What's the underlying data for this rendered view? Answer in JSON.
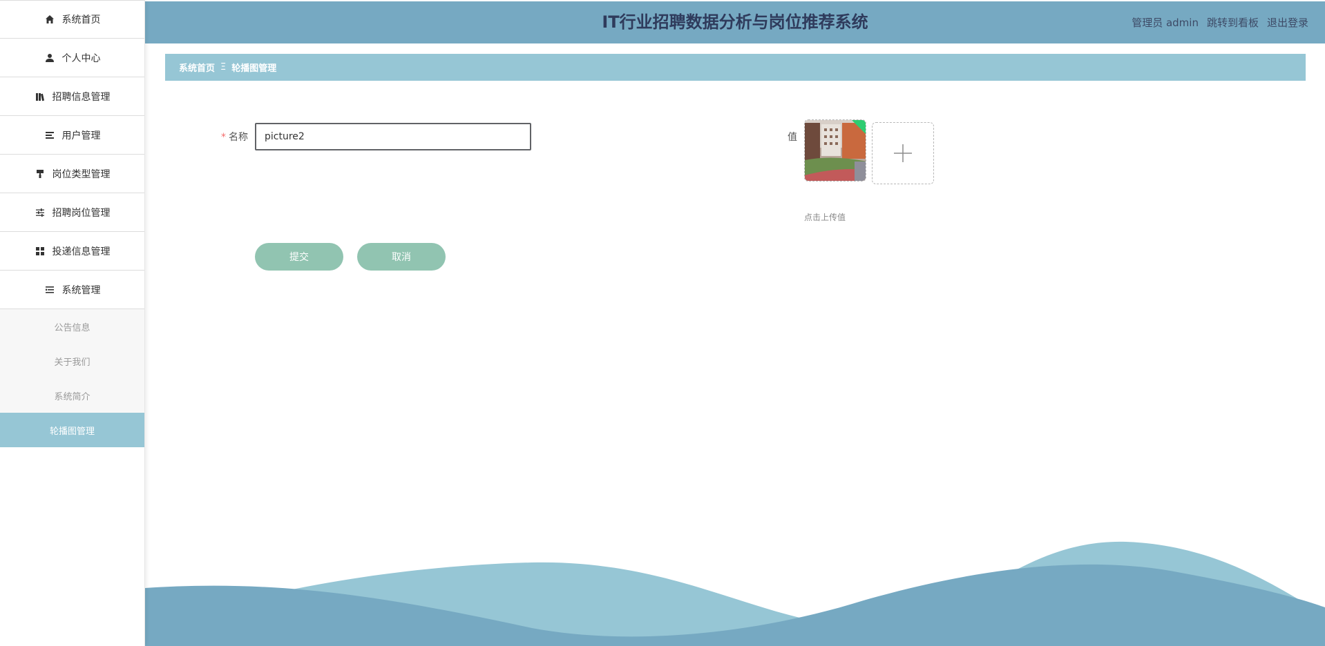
{
  "header": {
    "title": "IT行业招聘数据分析与岗位推荐系统",
    "user_label": "管理员 admin",
    "dashboard_link": "跳转到看板",
    "logout_link": "退出登录"
  },
  "sidebar": {
    "items": [
      {
        "label": "系统首页",
        "icon": "home-icon"
      },
      {
        "label": "个人中心",
        "icon": "user-icon"
      },
      {
        "label": "招聘信息管理",
        "icon": "library-icon"
      },
      {
        "label": "用户管理",
        "icon": "list-icon"
      },
      {
        "label": "岗位类型管理",
        "icon": "paint-roller-icon"
      },
      {
        "label": "招聘岗位管理",
        "icon": "sliders-icon"
      },
      {
        "label": "投递信息管理",
        "icon": "grid-icon"
      },
      {
        "label": "系统管理",
        "icon": "indent-list-icon"
      }
    ],
    "submenu": [
      {
        "label": "公告信息"
      },
      {
        "label": "关于我们"
      },
      {
        "label": "系统简介"
      },
      {
        "label": "轮播图管理",
        "active": true
      }
    ]
  },
  "breadcrumb": {
    "home": "系统首页",
    "separator": "Ξ",
    "current": "轮播图管理"
  },
  "form": {
    "name_required_mark": "*",
    "name_label": "名称",
    "name_value": "picture2",
    "value_label": "值",
    "upload_tip": "点击上传值",
    "submit_label": "提交",
    "cancel_label": "取消"
  },
  "colors": {
    "header_bg": "#76a9c2",
    "breadcrumb_bg": "#96c6d5",
    "active_menu_bg": "#96c6d5",
    "button_bg": "#91c4b1",
    "wave_dark": "#76a9c2",
    "wave_light": "#96c6d5"
  }
}
